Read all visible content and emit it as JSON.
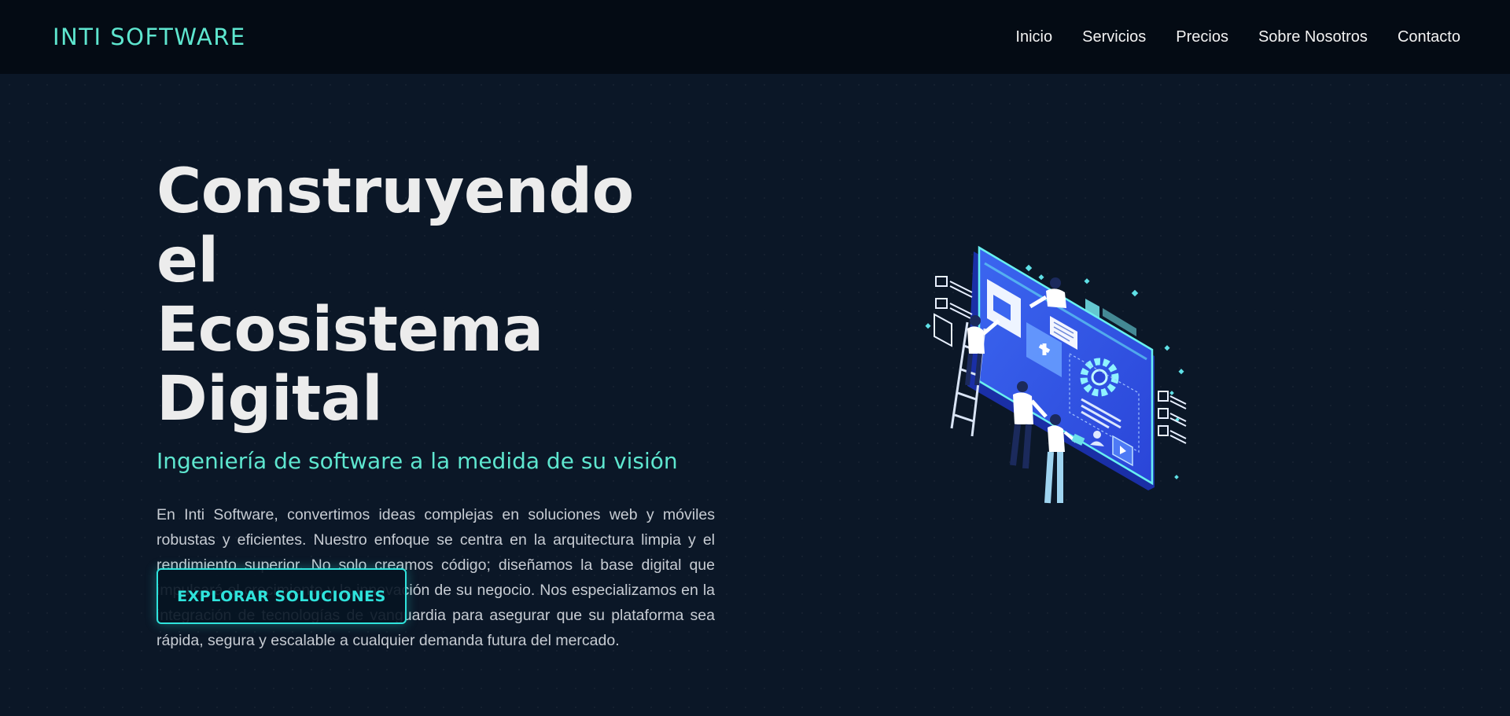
{
  "header": {
    "brand": "INTI SOFTWARE",
    "nav": [
      "Inicio",
      "Servicios",
      "Precios",
      "Sobre Nosotros",
      "Contacto"
    ]
  },
  "hero": {
    "title_line1": "Construyendo el",
    "title_line2": "Ecosistema Digital",
    "subtitle": "Ingeniería de software a la medida de su visión",
    "body": "En Inti Software, convertimos ideas complejas en soluciones web y móviles robustas y eficientes. Nuestro enfoque se centra en la arquitectura limpia y el rendimiento superior. No solo creamos código; diseñamos la base digital que impulsará el crecimiento y la innovación de su negocio. Nos especializamos en la integración de tecnologías de vanguardia para asegurar que su plataforma sea rápida, segura y escalable a cualquier demanda futura del mercado.",
    "cta_label": "EXPLORAR SOLUCIONES"
  },
  "colors": {
    "background": "#0b1727",
    "header_bg": "#040b14",
    "accent": "#5ee6cf",
    "cta_accent": "#2fe3dc",
    "illustration_blue": "#2f56e6"
  },
  "illustration": {
    "icon": "isometric-team-building-website-illustration"
  }
}
